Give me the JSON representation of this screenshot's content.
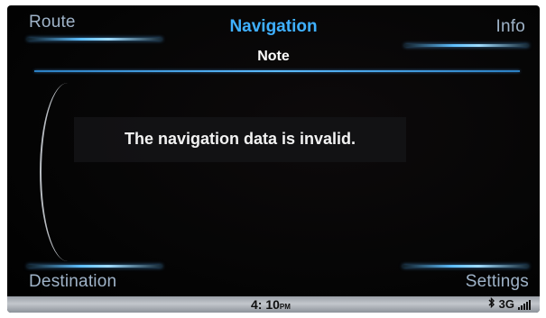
{
  "header": {
    "left_label": "Route",
    "title": "Navigation",
    "right_label": "Info",
    "subtitle": "Note"
  },
  "message": {
    "text": "The navigation data is invalid."
  },
  "footer": {
    "left_label": "Destination",
    "right_label": "Settings"
  },
  "status_bar": {
    "time": "4: 10",
    "ampm": "PM",
    "bluetooth_icon": "bluetooth-icon",
    "network": "3G",
    "signal_icon": "signal-strength-icon"
  },
  "colors": {
    "title_accent": "#3fb0ff",
    "corner_label": "#9fb3c8",
    "background": "#000000"
  }
}
